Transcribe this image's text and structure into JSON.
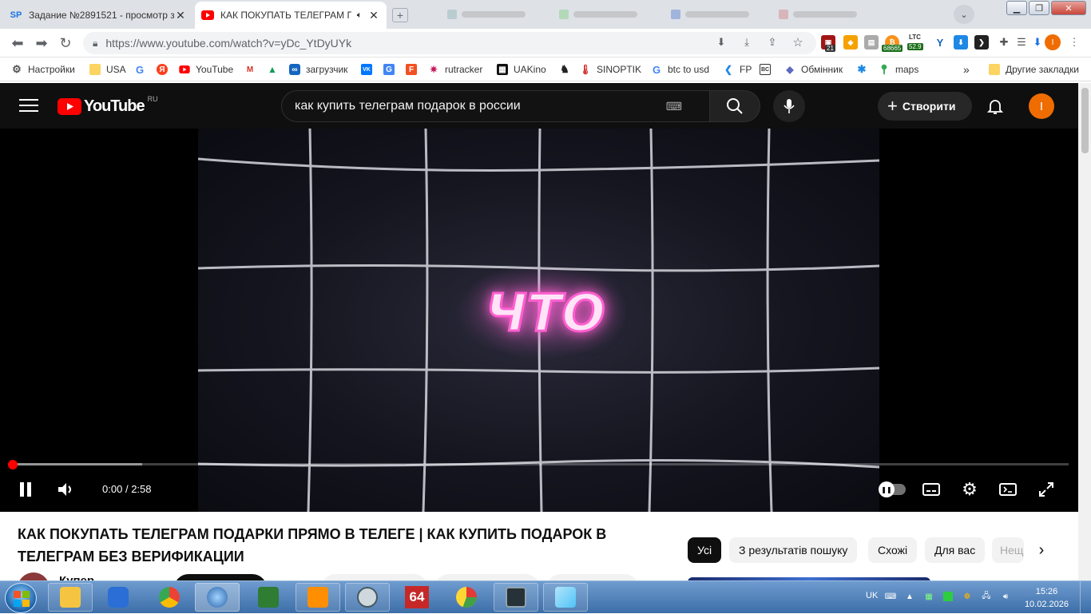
{
  "browser": {
    "tabs": [
      {
        "title": "Задание №2891521 - просмотр з",
        "favicon": "SP",
        "active": false
      },
      {
        "title": "КАК ПОКУПАТЬ ТЕЛЕГРАМ П",
        "favicon": "youtube",
        "active": true
      }
    ],
    "new_tab": "+",
    "url": "https://www.youtube.com/watch?v=yDc_YtDyUYk",
    "extensions": {
      "badge1": "21",
      "ltc_label": "LTC",
      "ltc_value": "52.9",
      "btc_value": "68665"
    },
    "profile_initial": "I",
    "bookmarks": [
      "Настройки",
      "USA",
      "G",
      "Я",
      "YouTube",
      "M",
      "загрузчик",
      "VK",
      "G",
      "F",
      "rutracker",
      "UAKino",
      "♞",
      "SINOPTIK",
      "btc to usd",
      "FP",
      "BC",
      "Обмінник",
      "✱",
      "maps"
    ],
    "bookmarks_more": "»",
    "other_bookmarks": "Другие закладки"
  },
  "youtube": {
    "logo_text": "YouTube",
    "region": "RU",
    "search_query": "как купить телеграм подарок в россии",
    "create_label": "Створити",
    "avatar_initial": "I"
  },
  "player": {
    "overlay_text": "ЧТО",
    "current_time": "0:00",
    "separator": "/",
    "duration": "2:58",
    "progress_played": 0.0,
    "progress_buffered": 0.125,
    "state": "playing"
  },
  "video": {
    "title": "КАК ПОКУПАТЬ ТЕЛЕГРАМ ПОДАРКИ ПРЯМО В ТЕЛЕГЕ | КАК КУПИТЬ ПОДАРОК В ТЕЛЕГРАМ БЕЗ ВЕРИФИКАЦИИ",
    "channel_partial": "Купер"
  },
  "chips": [
    "Усі",
    "З результатів пошуку",
    "Схожі",
    "Для вас",
    "Нещ"
  ],
  "taskbar": {
    "lang": "UK",
    "time": "15:26",
    "date": "10.02.2026",
    "app_64": "64"
  },
  "colors": {
    "yt_red": "#ff0000",
    "yt_dark": "#0f0f0f",
    "avatar": "#ef6c00",
    "neon_pink": "#ff5fd0"
  }
}
